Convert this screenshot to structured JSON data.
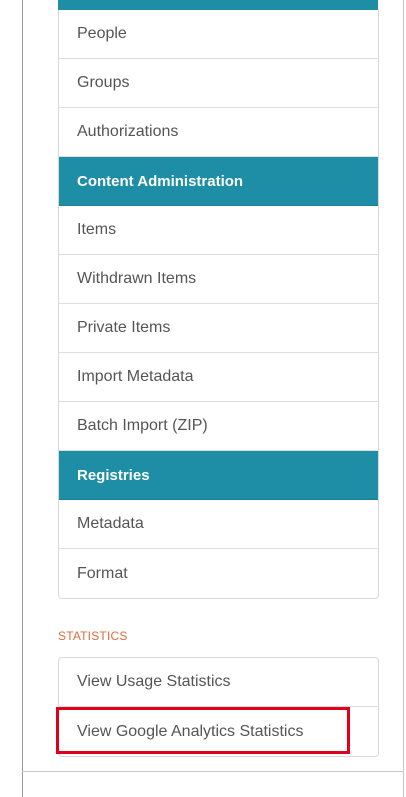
{
  "admin_menu": [
    {
      "label": "People",
      "type": "item"
    },
    {
      "label": "Groups",
      "type": "item"
    },
    {
      "label": "Authorizations",
      "type": "item"
    },
    {
      "label": "Content Administration",
      "type": "header"
    },
    {
      "label": "Items",
      "type": "item"
    },
    {
      "label": "Withdrawn Items",
      "type": "item"
    },
    {
      "label": "Private Items",
      "type": "item"
    },
    {
      "label": "Import Metadata",
      "type": "item"
    },
    {
      "label": "Batch Import (ZIP)",
      "type": "item"
    },
    {
      "label": "Registries",
      "type": "header"
    },
    {
      "label": "Metadata",
      "type": "item"
    },
    {
      "label": "Format",
      "type": "item"
    }
  ],
  "statistics": {
    "section_label": "STATISTICS",
    "items": [
      {
        "label": "View Usage Statistics"
      },
      {
        "label": "View Google Analytics Statistics",
        "highlighted": true
      }
    ]
  },
  "colors": {
    "header_bg": "#1d8ea6",
    "section_label": "#e06b3c",
    "highlight_border": "#e0001b"
  }
}
